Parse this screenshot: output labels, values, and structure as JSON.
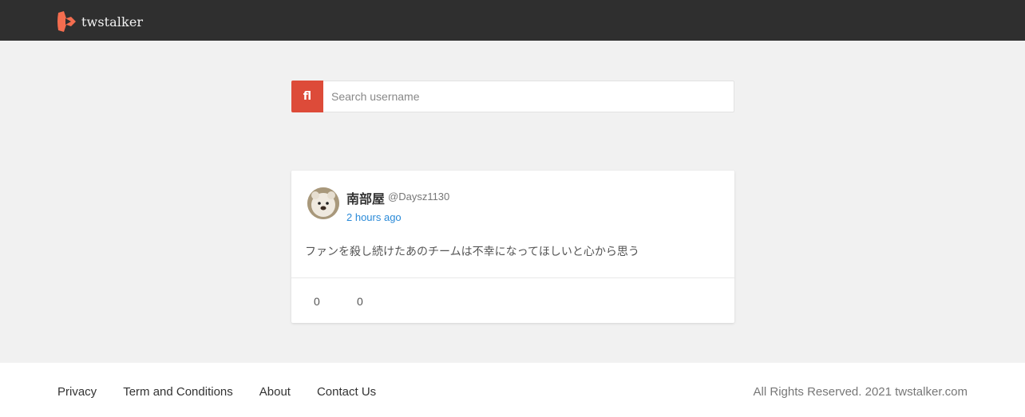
{
  "header": {
    "brand_name": "twstalker",
    "logo_color": "#f46d4f"
  },
  "search": {
    "button_glyph": "fl",
    "placeholder": "Search username",
    "value": "",
    "button_color": "#dd4b39"
  },
  "tweet": {
    "display_name": "南部屋",
    "handle": "@Daysz1130",
    "time": "2 hours ago",
    "text": "ファンを殺し続けたあのチームは不幸になってほしいと心から思う",
    "retweet_icon": "retweet-icon",
    "retweet_glyph": "",
    "retweets": "0",
    "like_icon": "heart-icon",
    "like_glyph": "",
    "likes": "0"
  },
  "footer": {
    "links": [
      "Privacy",
      "Term and Conditions",
      "About",
      "Contact Us"
    ],
    "copyright": "All Rights Reserved.  2021 twstalker.com"
  }
}
